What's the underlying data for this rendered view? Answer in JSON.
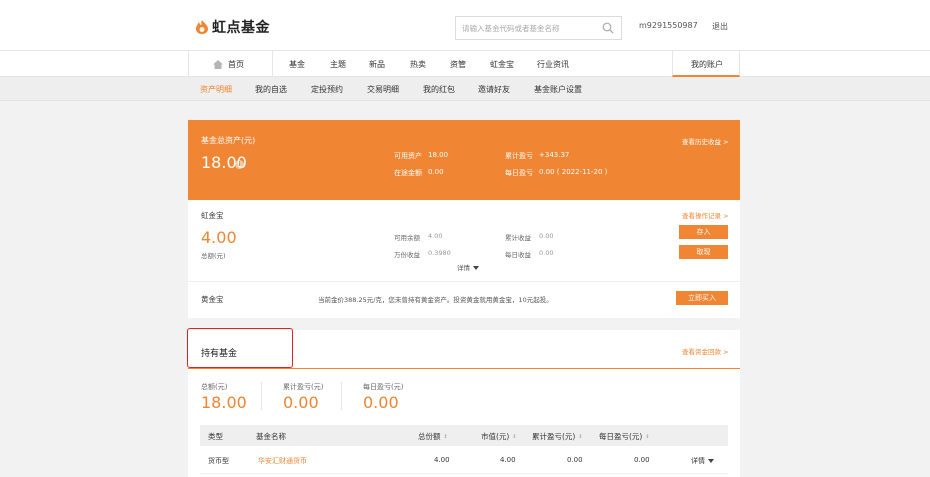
{
  "header": {
    "logo_text": "虹点基金",
    "search_placeholder": "请输入基金代码或者基金名称",
    "username": "m9291550987",
    "logout": "退出"
  },
  "nav": {
    "home": "首页",
    "items": [
      "基金",
      "主题",
      "新品",
      "热卖",
      "资管",
      "虹金宝",
      "行业资讯"
    ],
    "account": "我的账户"
  },
  "subnav": {
    "items": [
      "资产明细",
      "我的自选",
      "定投预约",
      "交易明细",
      "我的红包",
      "邀请好友",
      "基金账户设置"
    ],
    "active_index": 0
  },
  "summary": {
    "title": "基金总资产(元)",
    "total": "18.00",
    "info_glyph": "i",
    "history_link": "查看历史收益 >",
    "available_label": "可用资产",
    "available_value": "18.00",
    "in_transit_label": "在途金额",
    "in_transit_value": "0.00",
    "cum_profit_label": "累计盈亏",
    "cum_profit_value": "+343.37",
    "daily_profit_label": "每日盈亏",
    "daily_profit_value": "0.00 ( 2022-11-20 )"
  },
  "hongjinbao": {
    "title": "虹金宝",
    "ops_link": "查看操作记录 >",
    "amount": "4.00",
    "amount_label": "总额(元)",
    "balance_label": "可用余额",
    "balance_value": "4.00",
    "wanfen_label": "万份收益",
    "wanfen_value": "0.3980",
    "cum_income_label": "累计收益",
    "cum_income_value": "0.00",
    "daily_income_label": "每日收益",
    "daily_income_value": "0.00",
    "detail": "详情",
    "deposit": "存入",
    "withdraw": "取现"
  },
  "gold": {
    "title": "黄金宝",
    "message": "当前金价388.25元/克，您未曾持有黄金资产。投资黄金就用黄金宝，10元起投。",
    "buy": "立即买入"
  },
  "holdings": {
    "title": "持有基金",
    "link": "查看资金回款 >",
    "total_label": "总额(元)",
    "total_value": "18.00",
    "cum_label": "累计盈亏(元)",
    "cum_value": "0.00",
    "daily_label": "每日盈亏(元)",
    "daily_value": "0.00",
    "columns": [
      "类型",
      "基金名称",
      "总份额",
      "市值(元)",
      "累计盈亏(元)",
      "每日盈亏(元)"
    ],
    "sort_glyph": "⇕",
    "rows": [
      {
        "type": "货币型",
        "name": "华安汇财通货币",
        "shares": "4.00",
        "value": "4.00",
        "cum": "0.00",
        "daily": "0.00",
        "action": "详情"
      }
    ]
  },
  "colors": {
    "accent": "#f08533",
    "highlight": "#e02020"
  }
}
